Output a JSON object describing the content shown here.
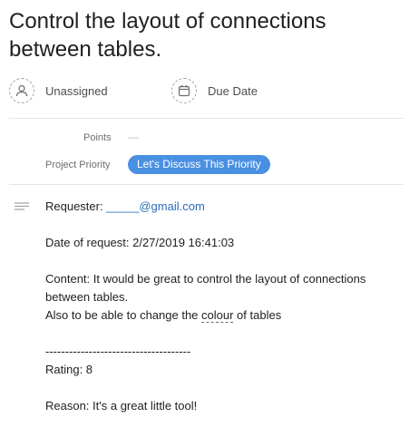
{
  "task": {
    "title": "Control the layout of connections between tables."
  },
  "assignee": {
    "label": "Unassigned",
    "icon": "user-icon"
  },
  "due_date": {
    "label": "Due Date",
    "icon": "calendar-icon"
  },
  "fields": {
    "points": {
      "label": "Points",
      "value": "—"
    },
    "priority": {
      "label": "Project Priority",
      "value": "Let's Discuss This Priority",
      "color": "#4a90e2"
    }
  },
  "description": {
    "requester_label": "Requester: ",
    "requester_email": "_____@gmail.com",
    "date_line": "Date of request: 2/27/2019 16:41:03",
    "content_line1": "Content: It would be great to control the layout of connections between tables.",
    "content_line2_before": "Also to be able to change the ",
    "content_line2_underlined": "colour",
    "content_line2_after": " of tables",
    "separator": "-------------------------------------",
    "rating": "Rating: 8",
    "reason": "Reason: It's a great little tool!"
  }
}
